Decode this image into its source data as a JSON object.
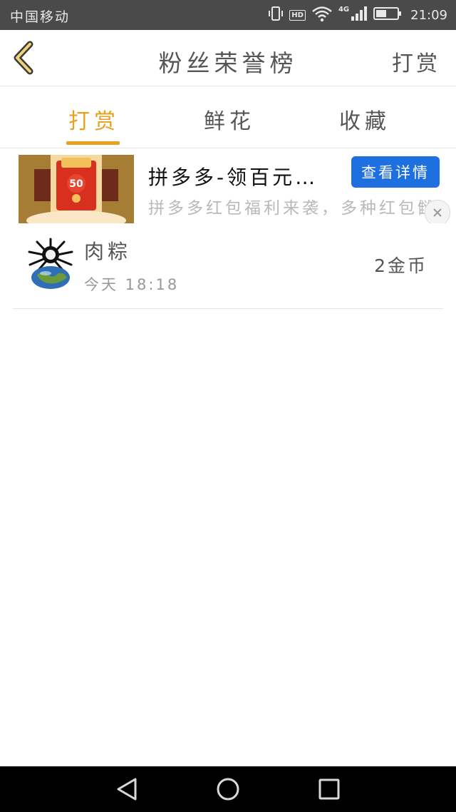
{
  "status_bar": {
    "carrier": "中国移动",
    "hd": "HD",
    "network": "4G",
    "time": "21:09"
  },
  "header": {
    "title": "粉丝荣誉榜",
    "action": "打赏",
    "back_icon": "chevron-left-icon",
    "accent_color": "#e8a11c"
  },
  "tabs": [
    {
      "label": "打赏",
      "active": true
    },
    {
      "label": "鲜花",
      "active": false
    },
    {
      "label": "收藏",
      "active": false
    }
  ],
  "ad": {
    "title": "拼多多-领百元…",
    "button_label": "查看详情",
    "description": "拼多多红包福利来袭，多种红包雠姆君任衆",
    "thumb_text": "50",
    "button_color": "#1e6fe0"
  },
  "list": [
    {
      "name": "肉粽",
      "time": "今天 18:18",
      "reward": "2金币"
    }
  ],
  "nav_bar": {
    "back_icon": "triangle-back-icon",
    "home_icon": "circle-home-icon",
    "recents_icon": "square-recents-icon"
  }
}
